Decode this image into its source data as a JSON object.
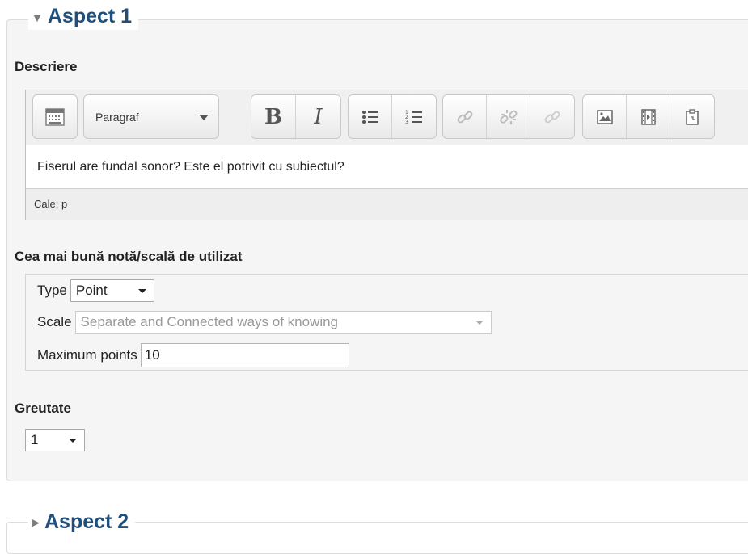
{
  "aspect1": {
    "title": "Aspect 1",
    "description_label": "Descriere",
    "editor": {
      "paragraph_format": "Paragraf",
      "bold": "B",
      "italic": "I",
      "content": "Fiserul are fundal sonor? Este el potrivit cu subiectul?",
      "path": "Cale: p"
    },
    "grade": {
      "label": "Cea mai bună notă/scală de utilizat",
      "type_label": "Type",
      "type_value": "Point",
      "scale_label": "Scale",
      "scale_value": "Separate and Connected ways of knowing",
      "max_points_label": "Maximum points",
      "max_points_value": "10"
    },
    "weight": {
      "label": "Greutate",
      "value": "1"
    }
  },
  "aspect2": {
    "title": "Aspect 2"
  }
}
